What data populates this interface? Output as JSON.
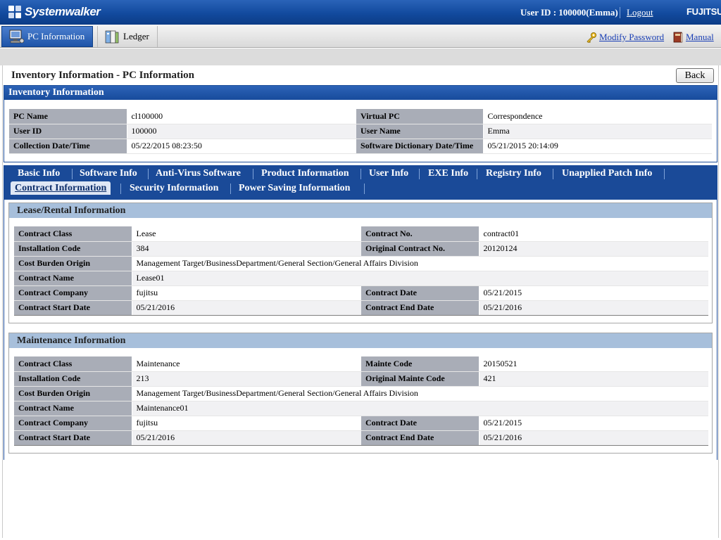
{
  "header": {
    "app_name": "Systemwalker",
    "user_label": "User ID : 100000(Emma)",
    "logout": "Logout",
    "vendor": "FUJITSU"
  },
  "toolbar": {
    "tabs": [
      {
        "label": "PC Information",
        "icon": "pc-icon",
        "active": true
      },
      {
        "label": "Ledger",
        "icon": "ledger-icon",
        "active": false
      }
    ],
    "modify_password": "Modify Password",
    "manual": "Manual"
  },
  "page": {
    "title": "Inventory Information - PC Information",
    "back": "Back"
  },
  "inventory": {
    "heading": "Inventory Information",
    "rows": [
      {
        "l1": "PC Name",
        "v1": "cl100000",
        "l2": "Virtual PC",
        "v2": "Correspondence"
      },
      {
        "l1": "User ID",
        "v1": "100000",
        "l2": "User Name",
        "v2": "Emma"
      },
      {
        "l1": "Collection Date/Time",
        "v1": "05/22/2015 08:23:50",
        "l2": "Software Dictionary Date/Time",
        "v2": "05/21/2015 20:14:09"
      }
    ]
  },
  "tabs": {
    "row1": [
      "Basic Info",
      "Software Info",
      "Anti-Virus Software",
      "Product Information",
      "User Info",
      "EXE Info",
      "Registry Info",
      "Unapplied Patch Info"
    ],
    "row2": [
      "Contract Information",
      "Security Information",
      "Power Saving Information"
    ],
    "active": "Contract Information"
  },
  "lease": {
    "heading": "Lease/Rental Information",
    "rows": [
      {
        "l1": "Contract Class",
        "v1": "Lease",
        "l2": "Contract No.",
        "v2": "contract01"
      },
      {
        "l1": "Installation Code",
        "v1": "384",
        "l2": "Original Contract No.",
        "v2": "20120124"
      },
      {
        "l1": "Cost Burden Origin",
        "v1": "Management Target/BusinessDepartment/General Section/General Affairs Division"
      },
      {
        "l1": "Contract Name",
        "v1": "Lease01"
      },
      {
        "l1": "Contract Company",
        "v1": "fujitsu",
        "l2": "Contract Date",
        "v2": "05/21/2015"
      },
      {
        "l1": "Contract Start Date",
        "v1": "05/21/2016",
        "l2": "Contract End Date",
        "v2": "05/21/2016"
      }
    ]
  },
  "maintenance": {
    "heading": "Maintenance Information",
    "rows": [
      {
        "l1": "Contract Class",
        "v1": "Maintenance",
        "l2": "Mainte Code",
        "v2": "20150521"
      },
      {
        "l1": "Installation Code",
        "v1": "213",
        "l2": "Original Mainte Code",
        "v2": "421"
      },
      {
        "l1": "Cost Burden Origin",
        "v1": "Management Target/BusinessDepartment/General Section/General Affairs Division"
      },
      {
        "l1": "Contract Name",
        "v1": "Maintenance01"
      },
      {
        "l1": "Contract Company",
        "v1": "fujitsu",
        "l2": "Contract Date",
        "v2": "05/21/2015"
      },
      {
        "l1": "Contract Start Date",
        "v1": "05/21/2016",
        "l2": "Contract End Date",
        "v2": "05/21/2016"
      }
    ]
  }
}
